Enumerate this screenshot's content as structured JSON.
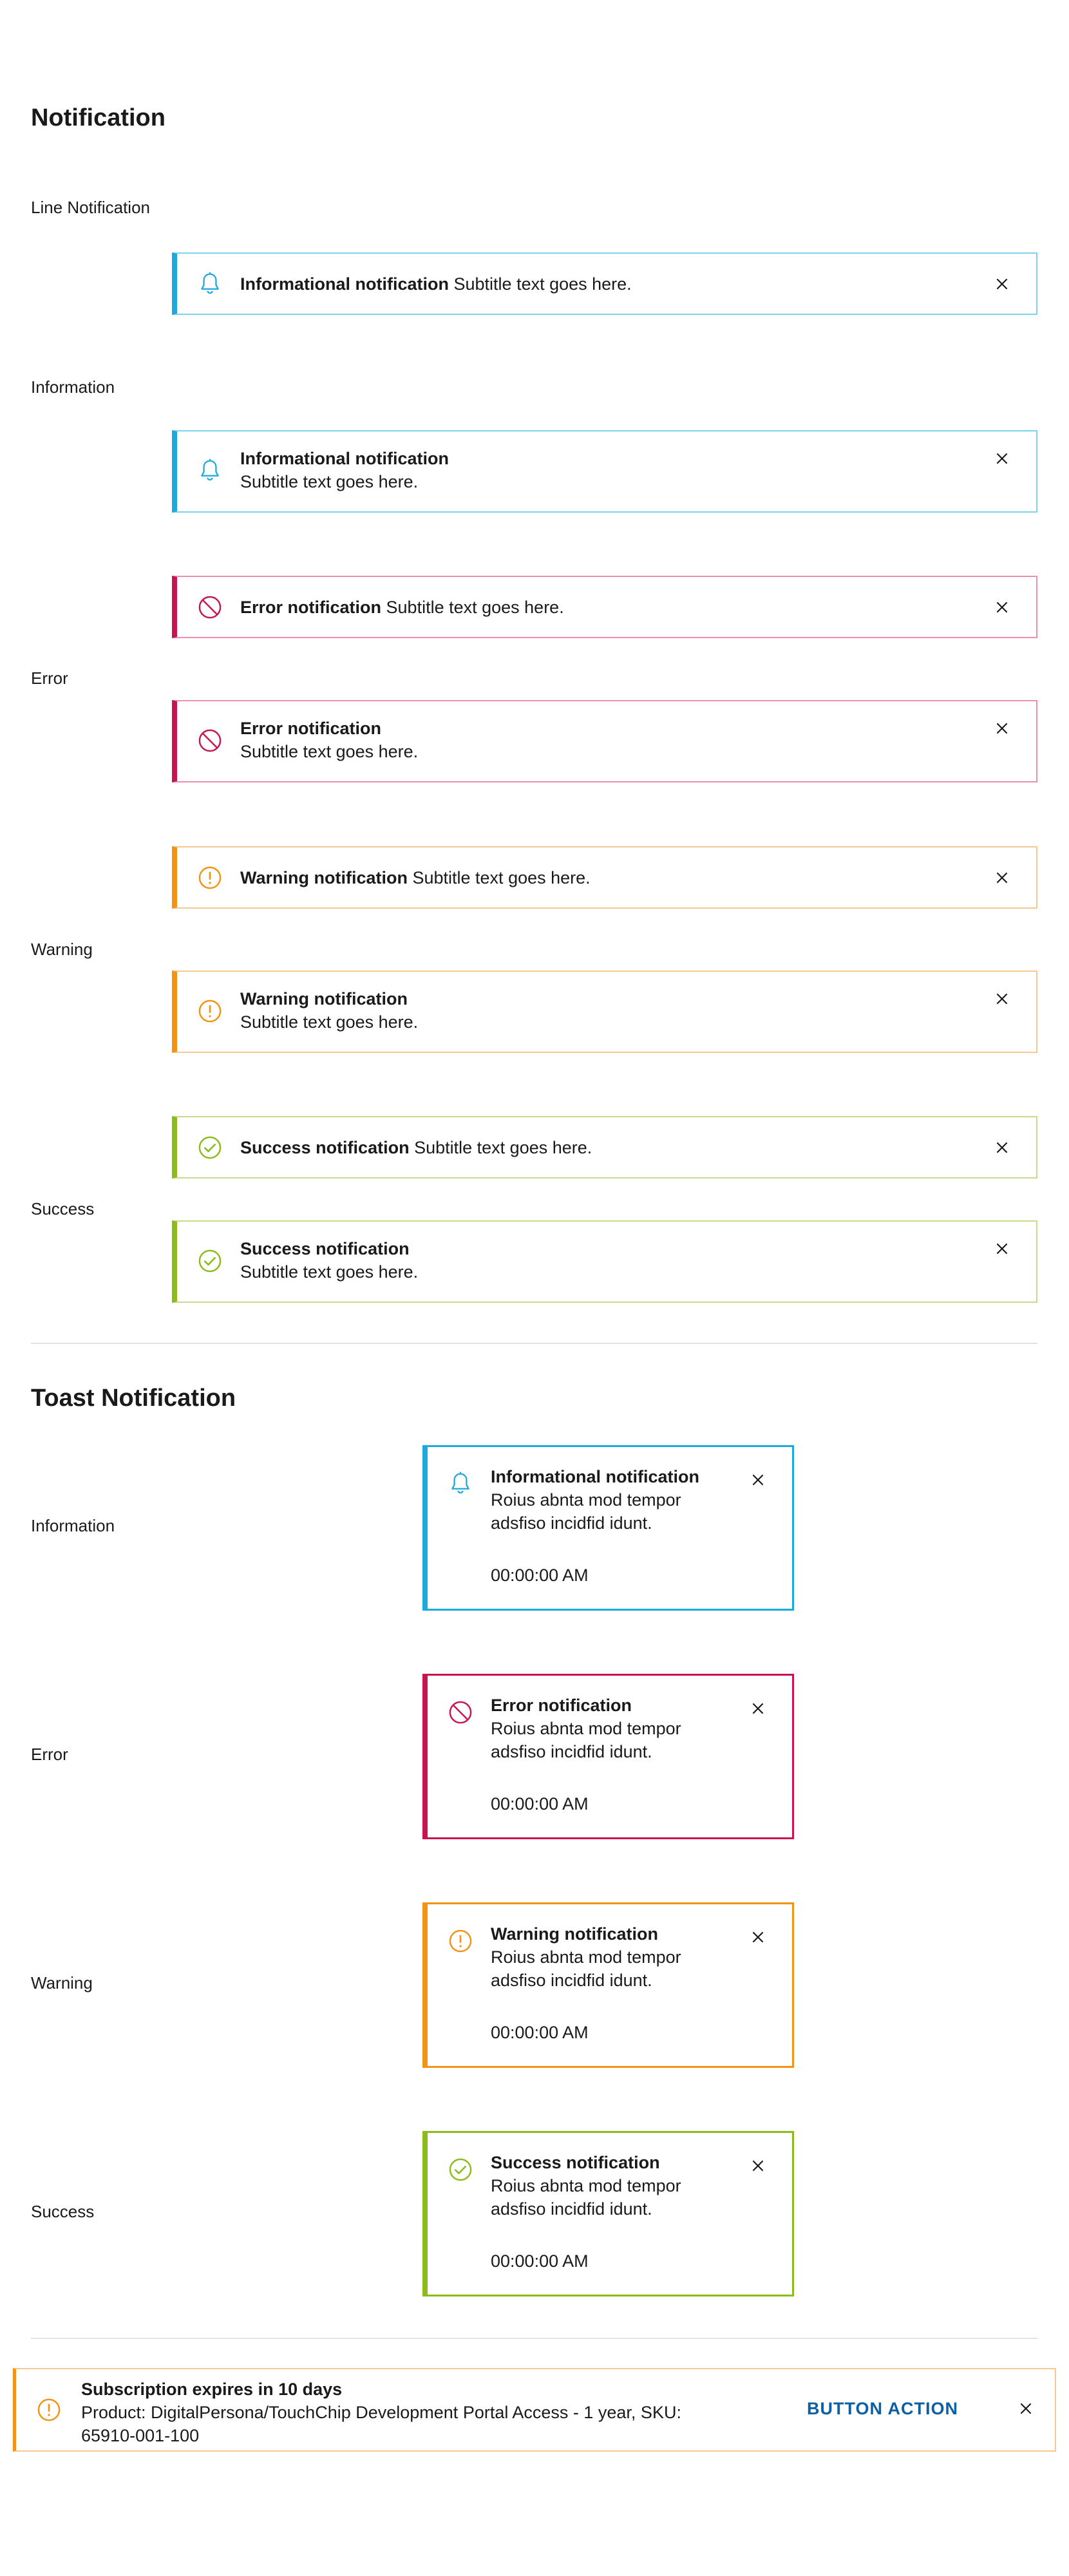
{
  "page_title": "Notification",
  "line_section": {
    "line_label": "Line Notification",
    "labels": {
      "information": "Information",
      "error": "Error",
      "warning": "Warning",
      "success": "Success"
    },
    "info_inline": {
      "title": "Informational notification",
      "subtitle": "Subtitle text goes here."
    },
    "info_stacked": {
      "title": "Informational notification",
      "subtitle": "Subtitle text goes here."
    },
    "error_inline": {
      "title": "Error notification",
      "subtitle": "Subtitle text goes here."
    },
    "error_stacked": {
      "title": "Error notification",
      "subtitle": "Subtitle text goes here."
    },
    "warning_inline": {
      "title": "Warning notification",
      "subtitle": "Subtitle text goes here."
    },
    "warning_stacked": {
      "title": "Warning notification",
      "subtitle": "Subtitle text goes here."
    },
    "success_inline": {
      "title": "Success notification",
      "subtitle": "Subtitle text goes here."
    },
    "success_stacked": {
      "title": "Success notification",
      "subtitle": "Subtitle text goes here."
    }
  },
  "toast_section": {
    "heading": "Toast Notification",
    "labels": {
      "information": "Information",
      "error": "Error",
      "warning": "Warning",
      "success": "Success"
    },
    "info": {
      "title": "Informational notification",
      "body": "Roius abnta mod tempor adsfiso incidfid idunt.",
      "time": "00:00:00 AM"
    },
    "error": {
      "title": "Error notification",
      "body": "Roius abnta mod tempor adsfiso incidfid idunt.",
      "time": "00:00:00 AM"
    },
    "warning": {
      "title": "Warning notification",
      "body": "Roius abnta mod tempor adsfiso incidfid idunt.",
      "time": "00:00:00 AM"
    },
    "success": {
      "title": "Success notification",
      "body": "Roius abnta mod tempor adsfiso incidfid idunt.",
      "time": "00:00:00 AM"
    }
  },
  "banner": {
    "title": "Subscription expires in 10 days",
    "body": "Product: DigitalPersona/TouchChip Development Portal Access - 1 year, SKU: 65910-001-100",
    "action_label": "BUTTON ACTION"
  },
  "icons": {
    "info": "bell-icon",
    "error": "prohibited-icon",
    "warning": "exclamation-circle-icon",
    "success": "check-circle-icon",
    "close": "close-icon"
  },
  "colors": {
    "info": "#1ea9dc",
    "error": "#c7164f",
    "warning": "#f29314",
    "success": "#8cbc1c",
    "action": "#0b5fa5"
  }
}
